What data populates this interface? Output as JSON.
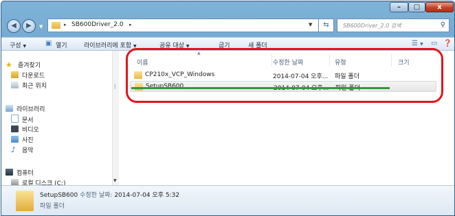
{
  "window": {
    "min_glyph": "–",
    "max_glyph": "□",
    "close_glyph": "x"
  },
  "address": {
    "crumb": "SB600Driver_2.0",
    "separator": "▸"
  },
  "search": {
    "placeholder": "SB600Driver_2.0 검색"
  },
  "toolbar": {
    "organize": "구성",
    "open": "열기",
    "include_in_library": "라이브러리에 포함",
    "share_with": "공유 대상",
    "burn": "굽기",
    "new_folder": "새 폴더"
  },
  "sidebar": {
    "favorites": "즐겨찾기",
    "downloads": "다운로드",
    "recent": "최근 위치",
    "libraries": "라이브러리",
    "documents": "문서",
    "videos": "비디오",
    "pictures": "사진",
    "music": "음악",
    "computer": "컴퓨터",
    "local_disk": "로컬 디스크 (C:)"
  },
  "columns": {
    "name": "이름",
    "modified": "수정한 날짜",
    "type": "유형",
    "size": "크기"
  },
  "files": [
    {
      "name": "CP210x_VCP_Windows",
      "modified": "2014-07-04 오후...",
      "type": "파일 폴더"
    },
    {
      "name": "SetupSB600",
      "modified": "2014-07-04 오후...",
      "type": "파일 폴더"
    }
  ],
  "details": {
    "name": "SetupSB600",
    "modified_label": "수정한 날짜:",
    "modified_value": "2014-07-04 오후 5:32",
    "type": "파일 폴더"
  },
  "colors": {
    "annotation_oval": "#e3121b",
    "annotation_underline": "#2e9c36"
  }
}
